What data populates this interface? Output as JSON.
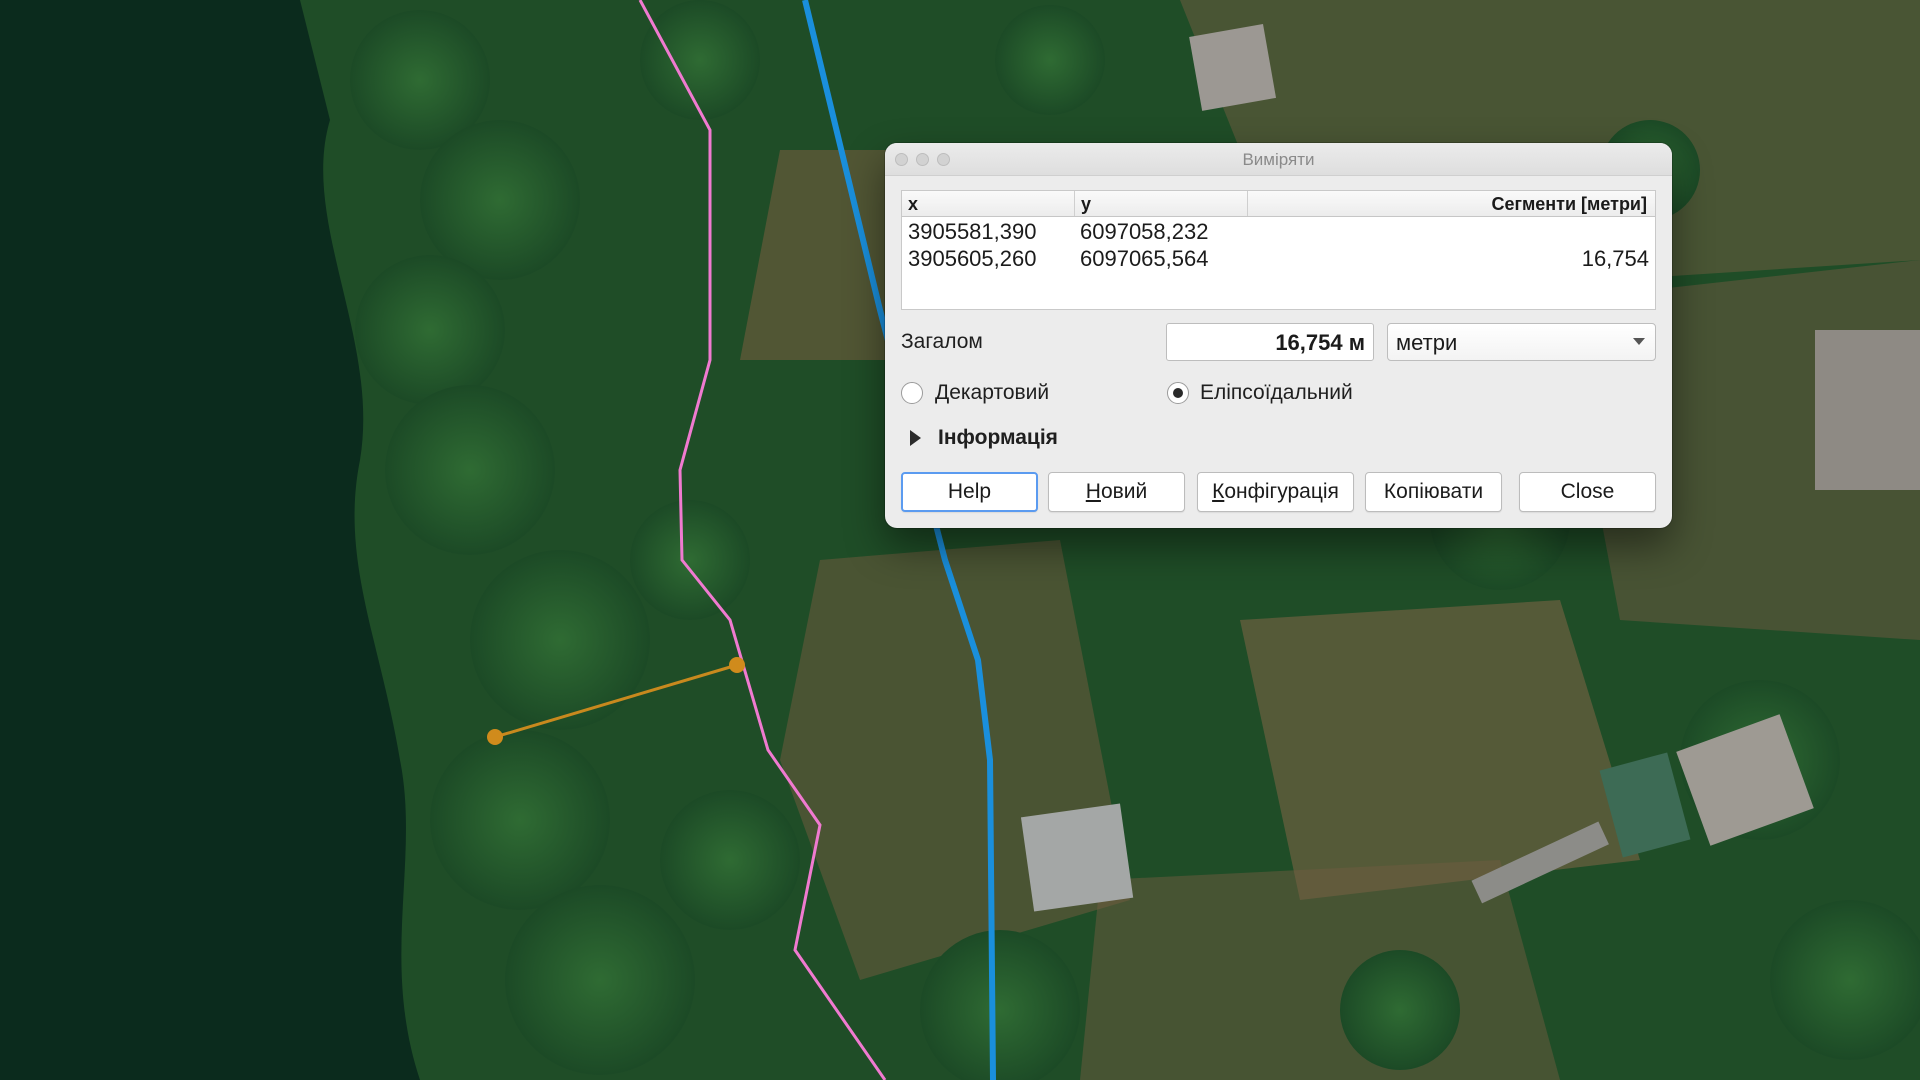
{
  "dialog": {
    "title": "Виміряти",
    "table": {
      "headers": {
        "x": "x",
        "y": "y",
        "segments": "Сегменти [метри]"
      },
      "rows": [
        {
          "x": "3905581,390",
          "y": "6097058,232",
          "segment": ""
        },
        {
          "x": "3905605,260",
          "y": "6097065,564",
          "segment": "16,754"
        }
      ]
    },
    "total_label": "Загалом",
    "total_value": "16,754 м",
    "units": {
      "selected": "метри"
    },
    "radios": {
      "cartesian": {
        "label": "Декартовий",
        "checked": false
      },
      "ellipsoidal": {
        "label": "Еліпсоїдальний",
        "checked": true
      }
    },
    "info_label": "Інформація",
    "buttons": {
      "help": "Help",
      "new_first": "Н",
      "new_rest": "овий",
      "config_first": "К",
      "config_rest": "онфігурація",
      "copy": "Копіювати",
      "close": "Close"
    }
  },
  "colors": {
    "blue_line": "#1a8fdc",
    "pink_line": "#f07ad0",
    "measure_line": "#c8891e"
  }
}
